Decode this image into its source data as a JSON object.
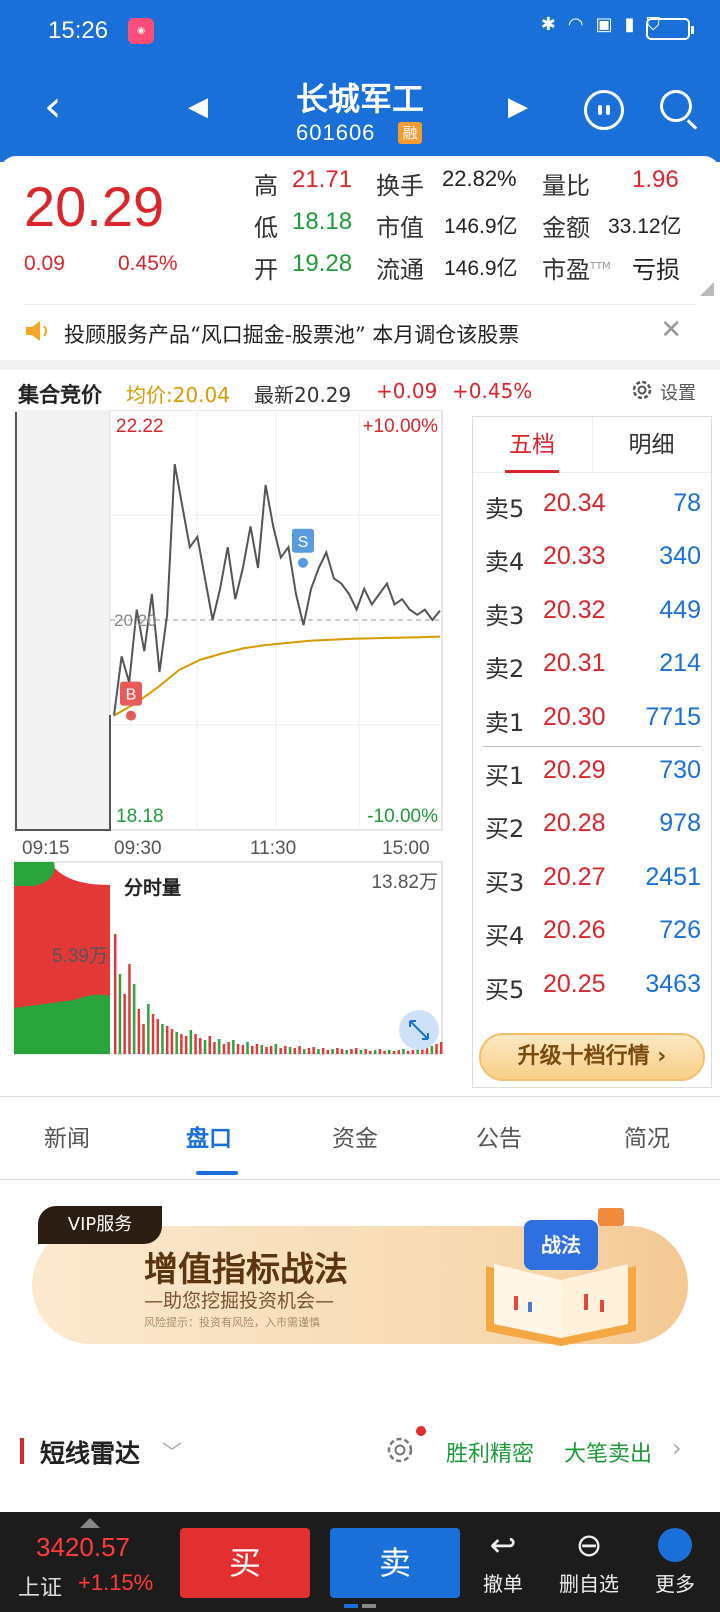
{
  "status_bar": {
    "time": "15:26"
  },
  "header": {
    "stock_name": "长城军工",
    "stock_code": "601606",
    "margin_badge": "融"
  },
  "quote": {
    "price": "20.29",
    "change": "0.09",
    "change_pct": "0.45%",
    "stats": [
      {
        "label": "高",
        "value": "21.71",
        "color": "red"
      },
      {
        "label": "换手",
        "value": "22.82%",
        "color": "dark"
      },
      {
        "label": "量比",
        "value": "1.96",
        "color": "red"
      },
      {
        "label": "低",
        "value": "18.18",
        "color": "green"
      },
      {
        "label": "市值",
        "value": "146.9亿",
        "color": "dark"
      },
      {
        "label": "金额",
        "value": "33.12亿",
        "color": "dark"
      },
      {
        "label": "开",
        "value": "19.28",
        "color": "green"
      },
      {
        "label": "流通",
        "value": "146.9亿",
        "color": "dark"
      },
      {
        "label": "市盈",
        "label_sup": "TTM",
        "value": "亏损",
        "color": "dark"
      }
    ],
    "notice": "投顾服务产品“风口掘金-股票池” 本月调仓该股票"
  },
  "chart_header": {
    "title": "集合竞价",
    "avg": "均价:20.04",
    "last": "最新20.29",
    "chg": "+0.09",
    "pct": "+0.45%",
    "settings": "设置"
  },
  "chart_data": {
    "type": "line",
    "title": "",
    "y_top_label": "22.22",
    "y_bottom_label": "18.18",
    "pct_top_label": "+10.00%",
    "pct_bottom_label": "-10.00%",
    "ref_price_label": "20.20",
    "ylim": [
      18.18,
      22.22
    ],
    "x_ticks": [
      "09:15",
      "09:30",
      "11:30",
      "15:00"
    ],
    "series": [
      {
        "values": [
          19.28,
          19.85,
          19.6,
          20.3,
          19.9,
          20.45,
          19.7,
          20.25,
          21.7,
          21.3,
          20.9,
          21.0,
          20.6,
          20.2,
          20.5,
          20.9,
          20.4,
          20.7,
          21.1,
          20.7,
          21.5,
          21.1,
          20.8,
          20.9,
          20.45,
          20.15,
          20.5,
          20.7,
          20.85,
          20.6,
          20.55,
          20.45,
          20.3,
          20.5,
          20.35,
          20.45,
          20.55,
          20.35,
          20.4,
          20.3,
          20.25,
          20.3,
          20.2,
          20.29
        ]
      },
      {
        "values": [
          19.28,
          19.4,
          19.55,
          19.72,
          19.82,
          19.88,
          19.93,
          19.96,
          19.98,
          20.0,
          20.01,
          20.02,
          20.025,
          20.03,
          20.035,
          20.04
        ]
      }
    ],
    "markers": [
      {
        "label": "B",
        "price": 19.28
      },
      {
        "label": "S",
        "price": 20.75
      }
    ],
    "volume": {
      "label": "分时量",
      "max_label": "13.82万",
      "auction_label": "5.39万"
    }
  },
  "orderbook": {
    "tab_active": "五档",
    "tab_other": "明细",
    "asks": [
      {
        "label": "卖5",
        "price": "20.34",
        "vol": "78"
      },
      {
        "label": "卖4",
        "price": "20.33",
        "vol": "340"
      },
      {
        "label": "卖3",
        "price": "20.32",
        "vol": "449"
      },
      {
        "label": "卖2",
        "price": "20.31",
        "vol": "214"
      },
      {
        "label": "卖1",
        "price": "20.30",
        "vol": "7715"
      }
    ],
    "bids": [
      {
        "label": "买1",
        "price": "20.29",
        "vol": "730"
      },
      {
        "label": "买2",
        "price": "20.28",
        "vol": "978"
      },
      {
        "label": "买3",
        "price": "20.27",
        "vol": "2451"
      },
      {
        "label": "买4",
        "price": "20.26",
        "vol": "726"
      },
      {
        "label": "买5",
        "price": "20.25",
        "vol": "3463"
      }
    ],
    "upgrade": "升级十档行情 ›"
  },
  "tabs": [
    "新闻",
    "盘口",
    "资金",
    "公告",
    "简况"
  ],
  "vip": {
    "tag": "VIP服务",
    "title": "增值指标战法",
    "sub": "—助您挖掘投资机会—",
    "risk": "风险提示：投资有风险，入市需谨慎",
    "book_label": "战法"
  },
  "radar": {
    "title": "短线雷达",
    "link1": "胜利精密",
    "link2": "大笔卖出"
  },
  "bottom": {
    "index_value": "3420.57",
    "index_name": "上证",
    "index_pct": "+1.15%",
    "buy": "买",
    "sell": "卖",
    "cancel": "撤单",
    "remove": "删自选",
    "more": "更多"
  },
  "colors": {
    "brand_blue": "#1a6fd8",
    "up_red": "#d9252b",
    "down_green": "#1f9a3a",
    "avg_gold": "#d79b00"
  }
}
